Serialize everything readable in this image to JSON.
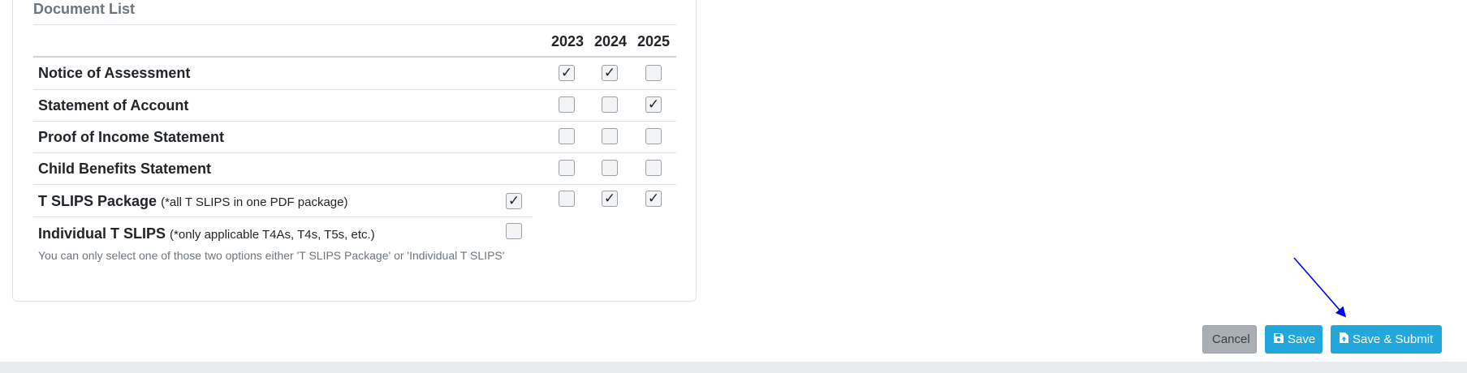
{
  "document_list": {
    "title": "Document List",
    "years": [
      "2023",
      "2024",
      "2025"
    ],
    "rows": [
      {
        "label": "Notice of Assessment",
        "checked": [
          true,
          true,
          false
        ]
      },
      {
        "label": "Statement of Account",
        "checked": [
          false,
          false,
          true
        ]
      },
      {
        "label": "Proof of Income Statement",
        "checked": [
          false,
          false,
          false
        ]
      },
      {
        "label": "Child Benefits Statement",
        "checked": [
          false,
          false,
          false
        ]
      },
      {
        "label": "T SLIPS Package",
        "note": "(*all T SLIPS in one PDF package)",
        "option_checked": true,
        "checked": [
          false,
          true,
          true
        ]
      },
      {
        "label": "Individual T SLIPS",
        "note": "(*only applicable T4As, T4s, T5s, etc.)",
        "option_checked": false
      }
    ],
    "help_text": "You can only select one of those two options either 'T SLIPS Package' or 'Individual T SLIPS'"
  },
  "actions": {
    "cancel_label": "Cancel",
    "save_label": "Save",
    "submit_label": "Save & Submit"
  },
  "colors": {
    "primary": "#22a7dd",
    "secondary": "#a9afb5",
    "annotation_arrow": "#0000ff"
  },
  "icons": {
    "save": "floppy-disk-icon",
    "submit": "file-upload-icon"
  }
}
